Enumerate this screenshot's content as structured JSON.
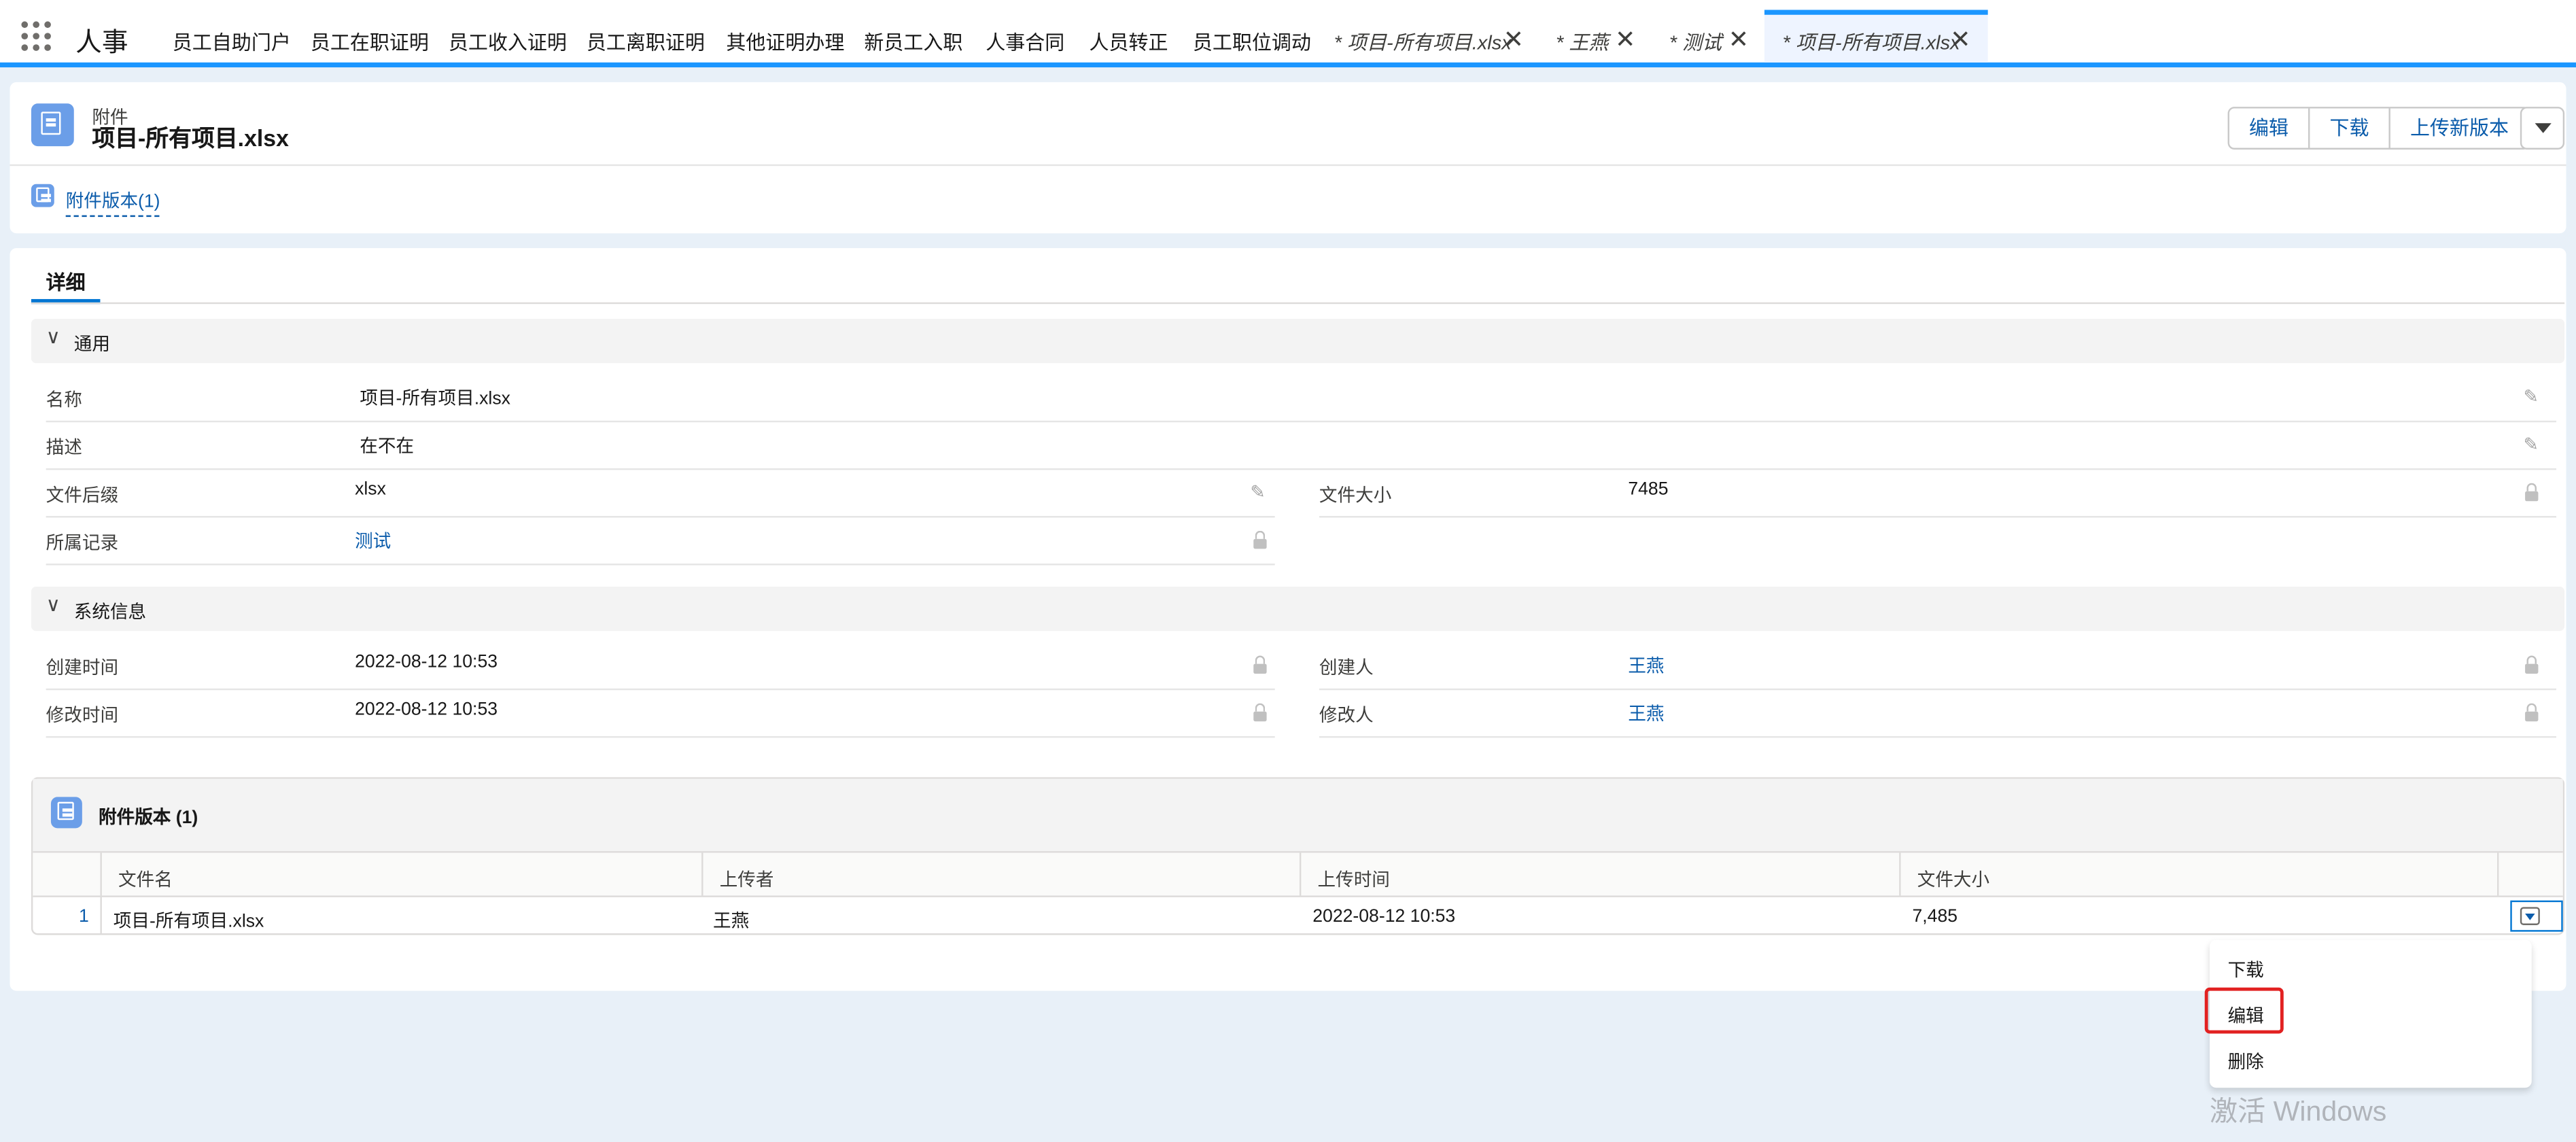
{
  "app": {
    "name": "人事"
  },
  "nav": {
    "items": [
      "员工自助门户",
      "员工在职证明",
      "员工收入证明",
      "员工离职证明",
      "其他证明办理",
      "新员工入职",
      "人事合同",
      "人员转正",
      "员工职位调动"
    ],
    "tabs": [
      {
        "label": "* 项目-所有项目.xlsx"
      },
      {
        "label": "* 王燕"
      },
      {
        "label": "* 测试"
      },
      {
        "label": "* 项目-所有项目.xlsx"
      }
    ]
  },
  "header": {
    "object_label": "附件",
    "title": "项目-所有项目.xlsx",
    "buttons": [
      "编辑",
      "下载",
      "上传新版本"
    ],
    "related_link": "附件版本(1)"
  },
  "detail": {
    "tab": "详细",
    "general": {
      "title": "通用",
      "name_label": "名称",
      "name_value": "项目-所有项目.xlsx",
      "desc_label": "描述",
      "desc_value": "在不在",
      "ext_label": "文件后缀",
      "ext_value": "xlsx",
      "size_label": "文件大小",
      "size_value": "7485",
      "record_label": "所属记录",
      "record_value": "测试"
    },
    "system": {
      "title": "系统信息",
      "created_label": "创建时间",
      "created_value": "2022-08-12 10:53",
      "creator_label": "创建人",
      "creator_value": "王燕",
      "modified_label": "修改时间",
      "modified_value": "2022-08-12 10:53",
      "modifier_label": "修改人",
      "modifier_value": "王燕"
    }
  },
  "versions": {
    "title": "附件版本 (1)",
    "columns": [
      "文件名",
      "上传者",
      "上传时间",
      "文件大小"
    ],
    "rows": [
      {
        "num": "1",
        "file": "项目-所有项目.xlsx",
        "uploader": "王燕",
        "time": "2022-08-12 10:53",
        "size": "7,485"
      }
    ]
  },
  "row_menu": {
    "items": [
      "下载",
      "编辑",
      "删除"
    ]
  },
  "watermark": "激活 Windows",
  "colors": {
    "accent": "#1b96ff",
    "link": "#0b5cab",
    "icon": "#6b9ee8",
    "highlight": "#e22121"
  }
}
